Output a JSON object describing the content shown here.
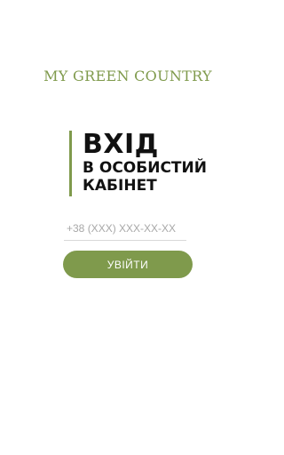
{
  "brand": {
    "logo_text": "MY GREEN COUNTRY",
    "accent_color": "#7f9a4c"
  },
  "login": {
    "title": "ВХІД",
    "subtitle_line1": "В ОСОБИСТИЙ",
    "subtitle_line2": "КАБІНЕТ",
    "phone_placeholder": "+38 (XXX) XXX-XX-XX",
    "phone_value": "",
    "submit_label": "УВІЙТИ"
  }
}
